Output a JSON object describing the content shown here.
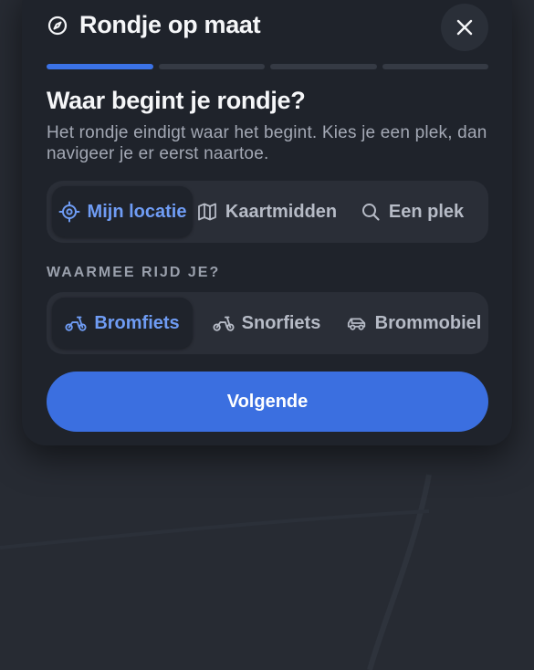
{
  "dialog": {
    "title": "Rondje op maat",
    "title_icon": "compass-icon",
    "close_icon": "close-icon"
  },
  "progress": {
    "total_steps": 4,
    "current_step": 1,
    "active_color": "#3b72e6"
  },
  "step": {
    "question": "Waar begint je rondje?",
    "description": "Het rondje eindigt waar het begint. Kies je een plek, dan navigeer je er eerst naartoe."
  },
  "start_options": [
    {
      "label": "Mijn locatie",
      "icon": "locate-icon",
      "selected": true
    },
    {
      "label": "Kaartmidden",
      "icon": "map-icon",
      "selected": false
    },
    {
      "label": "Een plek",
      "icon": "search-icon",
      "selected": false
    }
  ],
  "vehicle": {
    "label": "WAARMEE RIJD JE?",
    "options": [
      {
        "label": "Bromfiets",
        "icon": "moped-icon",
        "selected": true
      },
      {
        "label": "Snorfiets",
        "icon": "scooter-icon",
        "selected": false
      },
      {
        "label": "Brommobiel",
        "icon": "microcar-icon",
        "selected": false
      }
    ]
  },
  "next_button": {
    "label": "Volgende",
    "color": "#3b6fe0"
  },
  "colors": {
    "background": "#272b33",
    "sheet": "#1f232b",
    "accent": "#6f9cf4"
  }
}
